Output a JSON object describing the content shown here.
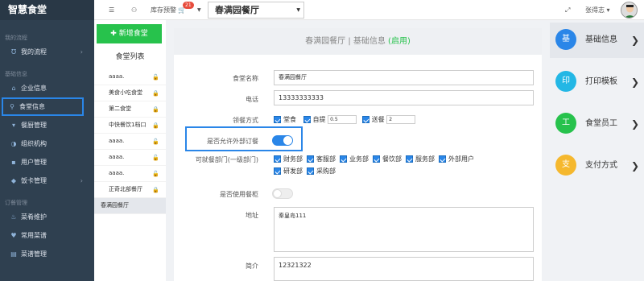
{
  "sidebar": {
    "logo": "智慧食堂",
    "sections": [
      "我的流程",
      "基础信息",
      "订餐管理"
    ],
    "items": [
      {
        "label": "我的流程",
        "icon": "flow-icon",
        "glyph": "Ʊ"
      },
      {
        "label": "企业信息",
        "icon": "home-icon",
        "glyph": "⌂"
      },
      {
        "label": "食堂信息",
        "icon": "location-pin-icon",
        "glyph": "⚲"
      },
      {
        "label": "餐厨管理",
        "icon": "cup-icon",
        "glyph": "▾"
      },
      {
        "label": "组织机构",
        "icon": "pie-icon",
        "glyph": "◑"
      },
      {
        "label": "用户管理",
        "icon": "user-icon",
        "glyph": "▪"
      },
      {
        "label": "饭卡管理",
        "icon": "card-icon",
        "glyph": "◆"
      },
      {
        "label": "菜肴维护",
        "icon": "fire-icon",
        "glyph": "♨"
      },
      {
        "label": "常用菜谱",
        "icon": "heart-icon",
        "glyph": "♥"
      },
      {
        "label": "菜谱管理",
        "icon": "book-icon",
        "glyph": "▤"
      }
    ]
  },
  "topbar": {
    "stock_alert": "库存预警",
    "badge": "21",
    "canteen_select": "春满园餐厅",
    "user": "张得志 ▾"
  },
  "list": {
    "add_button": "✚ 新增食堂",
    "heading": "食堂列表",
    "items": [
      {
        "name": "aaaa.",
        "lock": "🔓",
        "color": "#27c24c"
      },
      {
        "name": "美食小吃食堂",
        "lock": "🔒",
        "color": "#e74c3c"
      },
      {
        "name": "第二食堂",
        "lock": "🔒",
        "color": "#e74c3c"
      },
      {
        "name": "中快餐饮1档口",
        "lock": "🔒",
        "color": "#e74c3c"
      },
      {
        "name": "aaaa.",
        "lock": "🔓",
        "color": "#27c24c"
      },
      {
        "name": "aaaa.",
        "lock": "🔓",
        "color": "#27c24c"
      },
      {
        "name": "aaaa.",
        "lock": "🔓",
        "color": "#27c24c"
      },
      {
        "name": "正奇北部餐厅",
        "lock": "🔒",
        "color": "#e74c3c"
      },
      {
        "name": "春满园餐厅",
        "lock": "",
        "color": "#333"
      }
    ]
  },
  "form": {
    "header": "春满园餐厅 | 基础信息 ",
    "status": "(启用)",
    "name_label": "食堂名称",
    "name_value": "春满园餐厅",
    "phone_label": "电话",
    "phone_value": "13333333333",
    "pickup_label": "领餐方式",
    "pickup_dine": "堂食",
    "pickup_self": "自提",
    "pickup_self_value": "0.5",
    "pickup_deliver": "送餐",
    "pickup_deliver_value": "2",
    "allow_label": "是否允许外部订餐",
    "dept_label": "可就餐部门(一级部门)",
    "depts": [
      "财务部",
      "客服部",
      "业务部",
      "餐饮部",
      "服务部",
      "外部用户",
      "研发部",
      "采购部"
    ],
    "cabinet_label": "是否使用餐柜",
    "address_label": "地址",
    "address_value": "秦皇岛111",
    "intro_label": "简介",
    "intro_value": "12321322"
  },
  "right": {
    "items": [
      {
        "glyph": "基",
        "label": "基础信息",
        "color": "#2a86e8"
      },
      {
        "glyph": "印",
        "label": "打印模板",
        "color": "#23b7e5"
      },
      {
        "glyph": "工",
        "label": "食堂员工",
        "color": "#27c24c"
      },
      {
        "glyph": "支",
        "label": "支付方式",
        "color": "#f5b82e"
      }
    ]
  }
}
